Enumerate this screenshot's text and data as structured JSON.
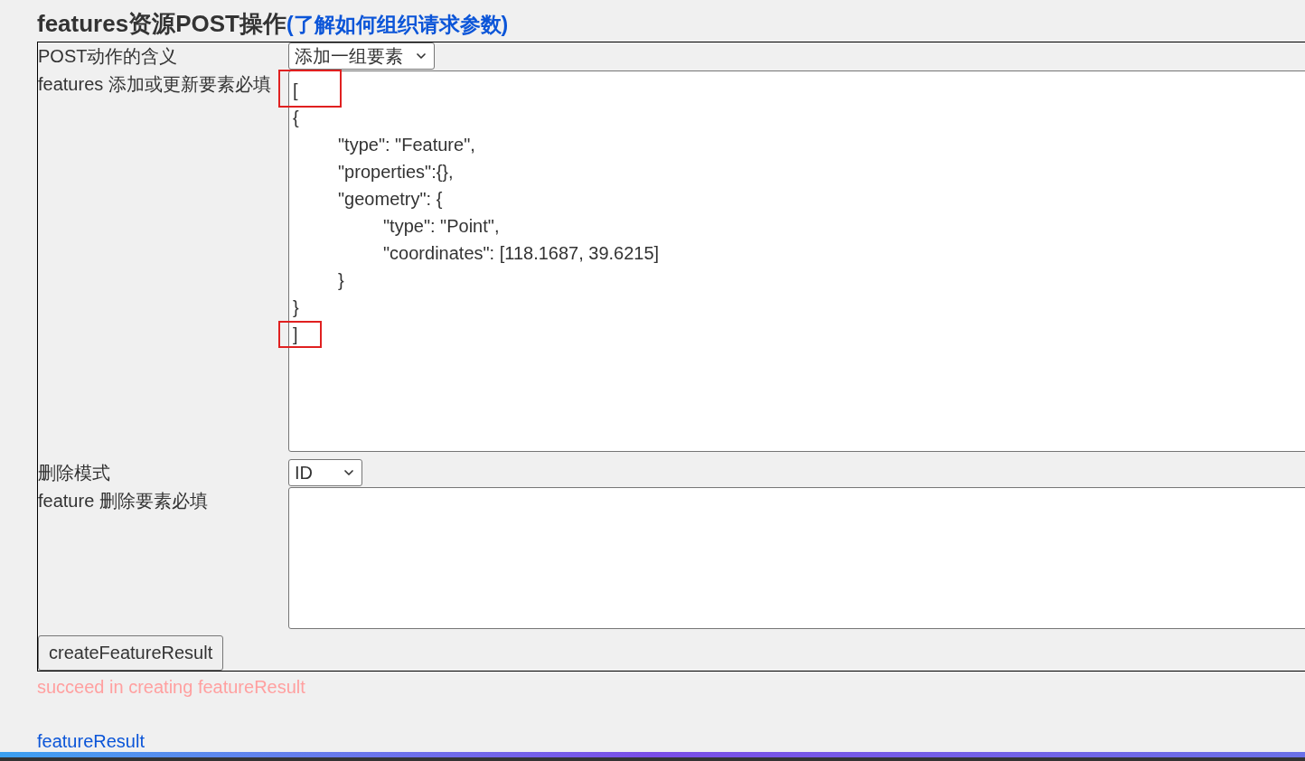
{
  "heading": {
    "title": "features资源POST操作",
    "link": "(了解如何组织请求参数)"
  },
  "form": {
    "rows": [
      {
        "kind": "select",
        "label": "POST动作的含义",
        "value": "添加一组要素"
      },
      {
        "kind": "textarea",
        "label": "features 添加或更新要素必填",
        "lines": [
          {
            "text": "[",
            "highlighted": true
          },
          {
            "text": "{",
            "highlighted": false
          },
          {
            "text": "\t\"type\": \"Feature\",",
            "highlighted": false
          },
          {
            "text": "\t\"properties\":{},",
            "highlighted": false
          },
          {
            "text": "\t\"geometry\": {",
            "highlighted": false
          },
          {
            "text": "\t\t\"type\": \"Point\",",
            "highlighted": false
          },
          {
            "text": "\t\t\"coordinates\": [118.1687, 39.6215]",
            "highlighted": false
          },
          {
            "text": "\t}",
            "highlighted": false
          },
          {
            "text": "}",
            "highlighted": false
          },
          {
            "text": "]",
            "highlighted": true
          }
        ]
      },
      {
        "kind": "select",
        "label": "删除模式",
        "value": "ID"
      },
      {
        "kind": "textarea",
        "label": "feature 删除要素必填",
        "lines": []
      }
    ],
    "button": "createFeatureResult"
  },
  "status_message": "succeed in creating featureResult",
  "result_link": "featureResult"
}
